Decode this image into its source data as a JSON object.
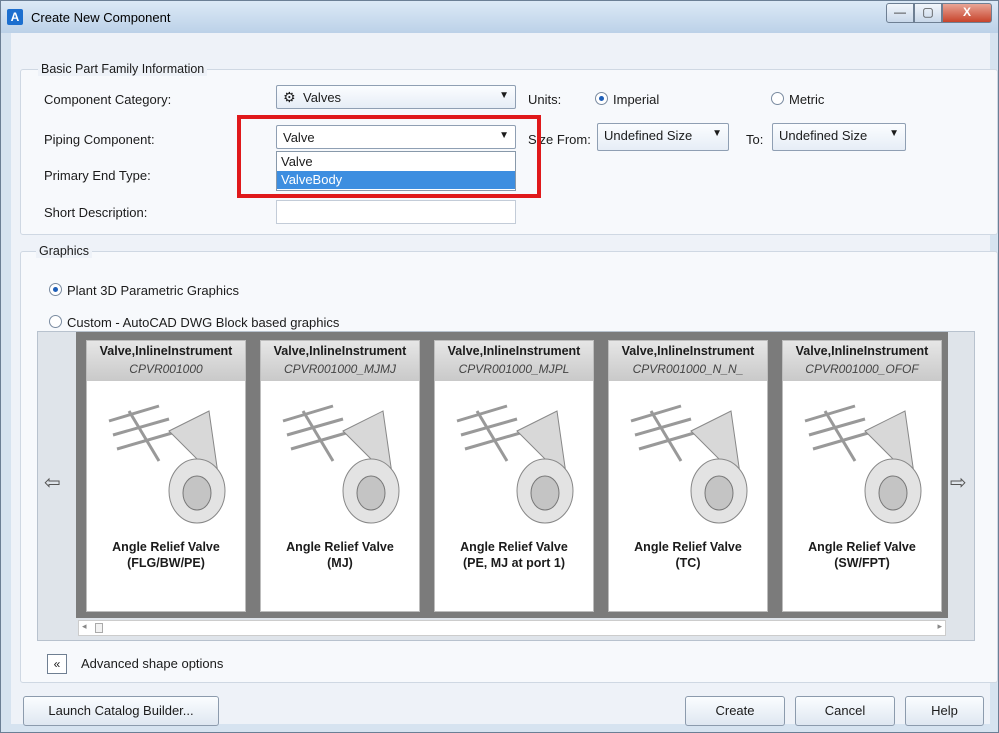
{
  "window": {
    "title": "Create New Component"
  },
  "basic": {
    "group_title": "Basic Part Family Information",
    "component_category_label": "Component Category:",
    "component_category_value": "Valves",
    "units_label": "Units:",
    "units_imperial": "Imperial",
    "units_metric": "Metric",
    "piping_component_label": "Piping Component:",
    "piping_component_value": "Valve",
    "size_from_label": "Size From:",
    "size_from_value": "Undefined Size",
    "to_label": "To:",
    "to_value": "Undefined Size",
    "primary_end_type_label": "Primary End Type:",
    "short_description_label": "Short Description:",
    "dropdown_options": [
      "Valve",
      "ValveBody"
    ]
  },
  "graphics": {
    "group_title": "Graphics",
    "option_parametric": "Plant 3D Parametric Graphics",
    "option_custom": "Custom - AutoCAD DWG Block based graphics",
    "advanced_label": "Advanced shape options",
    "cards": [
      {
        "type": "Valve,InlineInstrument",
        "code": "CPVR001000",
        "name_line1": "Angle Relief Valve",
        "name_line2": "(FLG/BW/PE)"
      },
      {
        "type": "Valve,InlineInstrument",
        "code": "CPVR001000_MJMJ",
        "name_line1": "Angle Relief Valve",
        "name_line2": "(MJ)"
      },
      {
        "type": "Valve,InlineInstrument",
        "code": "CPVR001000_MJPL",
        "name_line1": "Angle Relief Valve",
        "name_line2": "(PE, MJ at port 1)"
      },
      {
        "type": "Valve,InlineInstrument",
        "code": "CPVR001000_N_N_",
        "name_line1": "Angle Relief Valve",
        "name_line2": "(TC)"
      },
      {
        "type": "Valve,InlineInstrument",
        "code": "CPVR001000_OFOF",
        "name_line1": "Angle Relief Valve",
        "name_line2": "(SW/FPT)"
      }
    ]
  },
  "footer": {
    "launch_catalog_builder": "Launch Catalog Builder...",
    "create": "Create",
    "cancel": "Cancel",
    "help": "Help"
  },
  "icons": [
    "app-icon",
    "valve-icon",
    "left-arrow-icon",
    "right-arrow-icon",
    "double-chevron-left-icon"
  ],
  "colors": {
    "highlight": "#e0191b",
    "selected_option": "#3d8ee0"
  }
}
